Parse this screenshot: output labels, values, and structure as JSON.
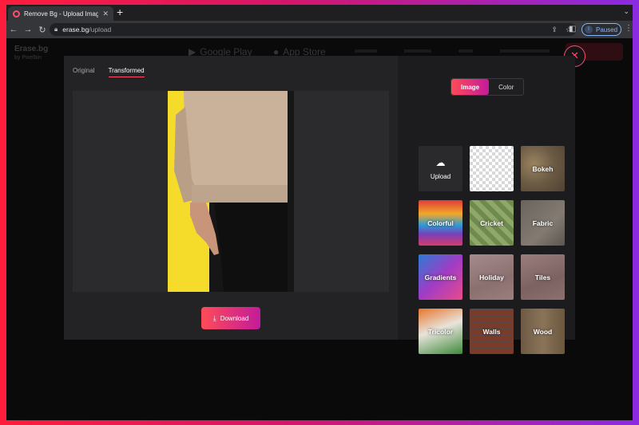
{
  "browser": {
    "tab_title": "Remove Bg - Upload Images to",
    "url_host": "erase.bg",
    "url_path": "/upload",
    "profile_initial": "I",
    "profile_status": "Paused"
  },
  "background_site": {
    "logo_line1": "Erase.bg",
    "logo_line2": "by Pixelbin",
    "google_play": "Google Play",
    "app_store": "App Store"
  },
  "editor": {
    "tabs": [
      {
        "label": "Original",
        "active": false
      },
      {
        "label": "Transformed",
        "active": true
      }
    ],
    "download_label": "Download",
    "close_icon": "close-icon",
    "photo_background_color": "#f6dc2a"
  },
  "background_picker": {
    "modes": [
      {
        "label": "Image",
        "active": true
      },
      {
        "label": "Color",
        "active": false
      }
    ],
    "tiles": [
      {
        "label": "Upload",
        "icon": "cloud-upload-icon"
      },
      {
        "label": ""
      },
      {
        "label": "Bokeh"
      },
      {
        "label": "Colorful"
      },
      {
        "label": "Cricket"
      },
      {
        "label": "Fabric"
      },
      {
        "label": "Gradients"
      },
      {
        "label": "Holiday"
      },
      {
        "label": "Tiles"
      },
      {
        "label": "Tricolor"
      },
      {
        "label": "Walls"
      },
      {
        "label": "Wood"
      }
    ]
  },
  "colors": {
    "accent_start": "#ff4b57",
    "accent_end": "#c31b9a",
    "close_ring": "#ff4d6d"
  }
}
